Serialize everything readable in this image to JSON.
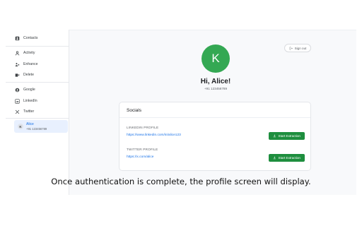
{
  "sidebar": {
    "items": [
      {
        "label": "Contacts",
        "icon": "contacts-icon"
      },
      {
        "label": "Activity",
        "icon": "activity-icon"
      },
      {
        "label": "Enhance",
        "icon": "enhance-icon"
      },
      {
        "label": "Delete",
        "icon": "delete-icon"
      },
      {
        "label": "Google",
        "icon": "google-icon"
      },
      {
        "label": "LinkedIn",
        "icon": "linkedin-icon"
      },
      {
        "label": "Twitter",
        "icon": "x-twitter-icon"
      }
    ],
    "user": {
      "initial": "K",
      "name": "Alice",
      "phone": "+91 123456789"
    }
  },
  "header": {
    "signout_label": "Sign out"
  },
  "profile": {
    "initial": "K",
    "greeting": "Hi, Alice!",
    "phone": "+91 123456789",
    "avatar_color": "#34a853"
  },
  "socials": {
    "title": "Socials",
    "linkedin": {
      "label": "LINKEDIN PROFILE",
      "url": "https://www.linkedin.com/in/alice123",
      "button": "Start Extraction"
    },
    "twitter": {
      "label": "TWITTER PROFILE",
      "url": "https://x.com/alice",
      "button": "Start Extraction"
    },
    "button_color": "#1e8e3e",
    "link_color": "#1a73e8"
  },
  "caption": "Once authentication is complete, the profile screen will display."
}
